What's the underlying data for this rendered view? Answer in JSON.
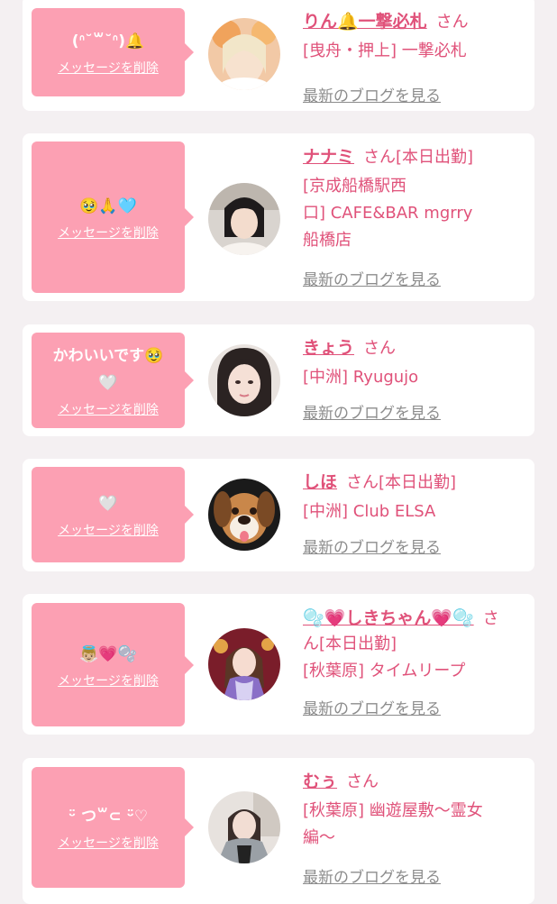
{
  "cards": [
    {
      "message": "(ᐢ˘꒳˘ᐢ)🔔",
      "delete_label": "メッセージを削除",
      "name": "りん🔔一撃必札",
      "san": "さん",
      "line1": "[曳舟・押上] 一撃必札",
      "blog": "最新のブログを見る"
    },
    {
      "message": "🥹🙏🩵",
      "delete_label": "メッセージを削除",
      "name": "ナナミ",
      "san": "さん[本日出勤]",
      "line1": "[京成船橋駅西",
      "line2": "口] CAFE&BAR mgrry",
      "line3": "船橋店",
      "blog": "最新のブログを見る"
    },
    {
      "message": "かわいいです🥹",
      "message2": "🤍",
      "delete_label": "メッセージを削除",
      "name": "きょう",
      "san": "さん",
      "line1": "[中洲] Ryugujo",
      "blog": "最新のブログを見る"
    },
    {
      "message": "🤍",
      "delete_label": "メッセージを削除",
      "name": "しほ",
      "san": "さん[本日出勤]",
      "line1": "[中洲] Club ELSA",
      "blog": "最新のブログを見る"
    },
    {
      "message": "👼🏼💗🫧",
      "delete_label": "メッセージを削除",
      "name": "🫧💗しきちゃん💗🫧",
      "san": "さ",
      "line1": "ん[本日出勤]",
      "line2": "[秋葉原] タイムリープ",
      "blog": "最新のブログを見る"
    },
    {
      "message": "ᵕ̈ つ꒳⊂ ᵕ̈♡",
      "delete_label": "メッセージを削除",
      "name": "むぅ",
      "san": "さん",
      "line1": "[秋葉原] 幽遊屋敷〜霊女",
      "line2": "編〜",
      "blog": "最新のブログを見る"
    }
  ]
}
